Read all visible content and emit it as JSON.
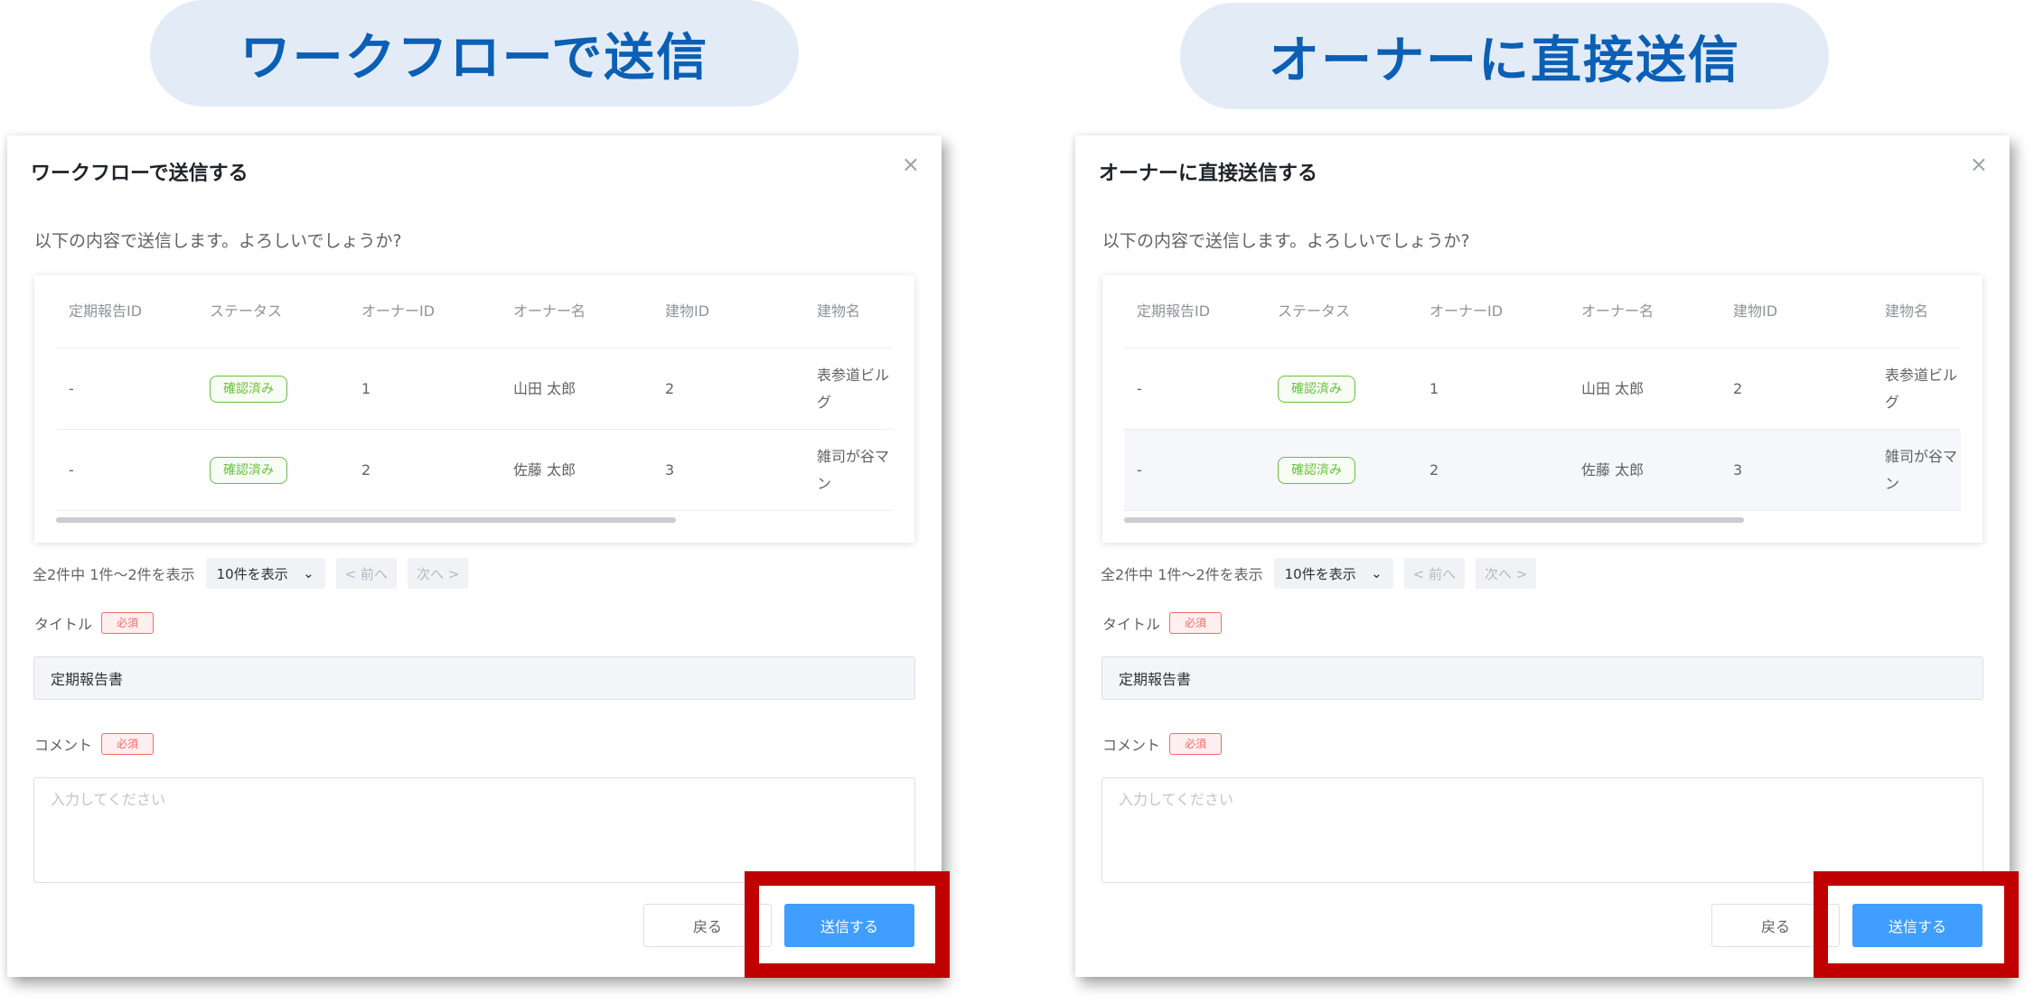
{
  "headers": {
    "left": "ワークフローで送信",
    "right": "オーナーに直接送信"
  },
  "dialogs": {
    "left": {
      "title": "ワークフローで送信する"
    },
    "right": {
      "title": "オーナーに直接送信する"
    }
  },
  "common": {
    "description": "以下の内容で送信します。よろしいでしょうか?",
    "close_icon": "×",
    "columns": [
      "定期報告ID",
      "ステータス",
      "オーナーID",
      "オーナー名",
      "建物ID",
      "建物名"
    ],
    "rows": [
      {
        "report_id": "-",
        "status": "確認済み",
        "owner_id": "1",
        "owner_name": "山田 太郎",
        "building_id": "2",
        "building_name": "表参道ビルグ"
      },
      {
        "report_id": "-",
        "status": "確認済み",
        "owner_id": "2",
        "owner_name": "佐藤 太郎",
        "building_id": "3",
        "building_name": "雑司が谷マン"
      }
    ],
    "pager": {
      "summary": "全2件中 1件〜2件を表示",
      "page_size": "10件を表示",
      "prev": "< 前へ",
      "next": "次へ >"
    },
    "title_label": "タイトル",
    "required": "必須",
    "title_value": "定期報告書",
    "comment_label": "コメント",
    "comment_placeholder": "入力してください",
    "back": "戻る",
    "send": "送信する"
  },
  "colors": {
    "accent": "#409eff",
    "header_text": "#0b5fb5",
    "header_bg": "#e3ecf6",
    "highlight": "#c00000",
    "status": "#67c23a",
    "required": "#f56c6c"
  }
}
